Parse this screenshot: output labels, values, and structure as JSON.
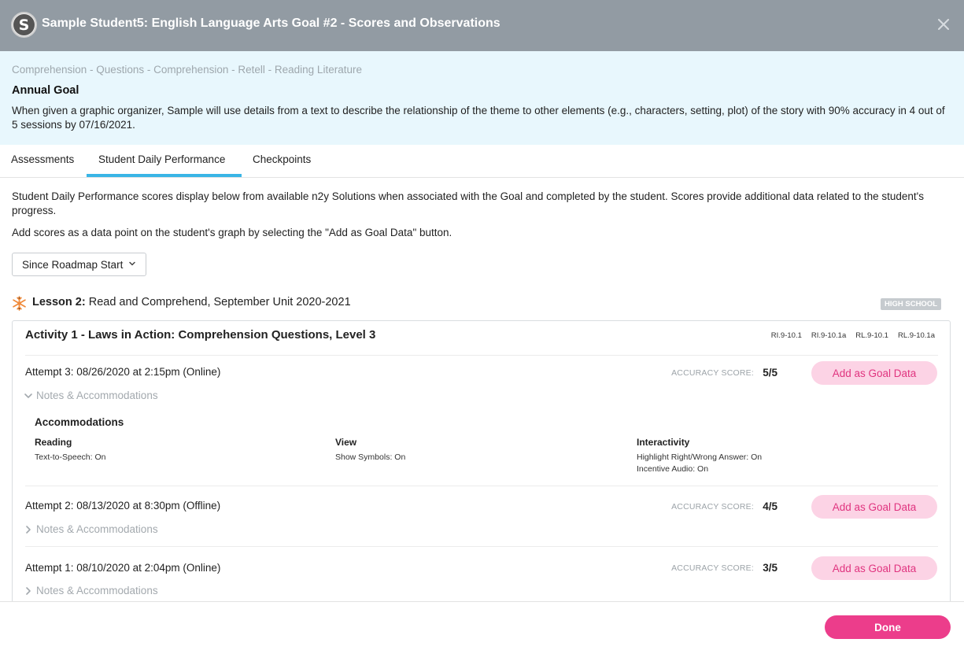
{
  "header": {
    "title": "Sample Student5: English Language Arts Goal #2 - Scores and Observations",
    "logo_letter": "S"
  },
  "goal": {
    "breadcrumb": "Comprehension - Questions - Comprehension - Retell - Reading Literature",
    "heading": "Annual Goal",
    "text": "When given a graphic organizer, Sample will use details from a text to describe the relationship of the theme to other elements (e.g., characters, setting, plot) of the story with 90% accuracy in 4 out of 5 sessions by 07/16/2021."
  },
  "tabs": [
    {
      "label": "Assessments",
      "active": false
    },
    {
      "label": "Student Daily Performance",
      "active": true
    },
    {
      "label": "Checkpoints",
      "active": false
    }
  ],
  "intro": {
    "line1": "Student Daily Performance scores display below from available n2y Solutions when associated with the Goal and completed by the student. Scores provide additional data related to the student's progress.",
    "line2": "Add scores as a data point on the student's graph by selecting the \"Add as Goal Data\" button."
  },
  "filter": {
    "selected": "Since Roadmap Start"
  },
  "lesson": {
    "label": "Lesson 2:",
    "title": " Read and Comprehend, September Unit 2020-2021",
    "level": "HIGH SCHOOL"
  },
  "activity": {
    "title": "Activity 1 - Laws in Action: Comprehension Questions, Level 3",
    "standards": [
      "RI.9-10.1",
      "RI.9-10.1a",
      "RL.9-10.1",
      "RL.9-10.1a"
    ]
  },
  "attempts": [
    {
      "label": "Attempt 3: 08/26/2020 at 2:15pm (Online)",
      "score_label": "ACCURACY SCORE:",
      "score": "5/5",
      "button": "Add as Goal Data",
      "notes_label": "Notes & Accommodations",
      "expanded": true
    },
    {
      "label": "Attempt 2: 08/13/2020 at 8:30pm (Offline)",
      "score_label": "ACCURACY SCORE:",
      "score": "4/5",
      "button": "Add as Goal Data",
      "notes_label": "Notes & Accommodations",
      "expanded": false
    },
    {
      "label": "Attempt 1: 08/10/2020 at 2:04pm (Online)",
      "score_label": "ACCURACY SCORE:",
      "score": "3/5",
      "button": "Add as Goal Data",
      "notes_label": "Notes & Accommodations",
      "expanded": false
    }
  ],
  "accommodations": {
    "heading": "Accommodations",
    "reading": {
      "title": "Reading",
      "values": [
        "Text-to-Speech: On"
      ]
    },
    "view": {
      "title": "View",
      "values": [
        "Show Symbols: On"
      ]
    },
    "interactivity": {
      "title": "Interactivity",
      "values": [
        "Highlight Right/Wrong Answer: On",
        "Incentive Audio: On"
      ]
    }
  },
  "footer": {
    "done_label": "Done"
  },
  "colors": {
    "header_bg": "#929ba3",
    "goal_bg": "#e8f7fd",
    "tab_active": "#39b5e6",
    "goal_button_bg": "#fcd3e5",
    "goal_button_text": "#e0347f",
    "done_bg": "#ec3d8b",
    "lesson_icon": "#f08a3a"
  },
  "icons": [
    "close-icon",
    "chevron-down-icon",
    "chevron-right-icon",
    "snowflake-icon"
  ]
}
